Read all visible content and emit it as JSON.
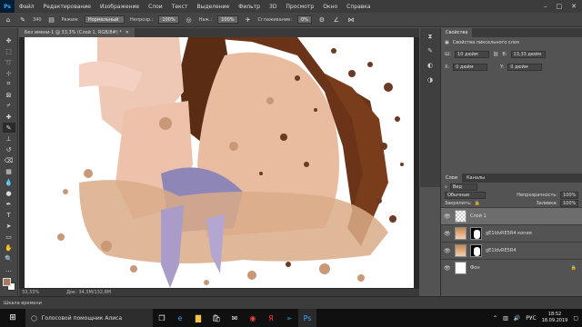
{
  "menu": {
    "items": [
      "Файл",
      "Редактирование",
      "Изображение",
      "Слои",
      "Текст",
      "Выделение",
      "Фильтр",
      "3D",
      "Просмотр",
      "Окно",
      "Справка"
    ]
  },
  "options": {
    "size": "340",
    "mode_label": "Режим:",
    "mode_value": "Нормальный",
    "opacity_label": "Непрозр.:",
    "opacity_value": "100%",
    "press_label": "Наж.:",
    "press_value": "100%",
    "smooth_label": "Сглаживание:",
    "smooth_value": "0%"
  },
  "document": {
    "tab_title": "Без имени-1 @ 33,3% (Слой 1, RGB/8#) *",
    "zoom": "33,33%",
    "doc_size": "Док: 34,3М/132,8М"
  },
  "timeline": {
    "label": "Шкала времени"
  },
  "properties": {
    "tab": "Свойства",
    "header": "Свойства пиксельного слоя",
    "w_label": "Ш:",
    "w_value": "10 дюйм",
    "h_label": "В:",
    "h_value": "13,33 дюйм",
    "x_label": "X:",
    "x_value": "0 дюйм",
    "y_label": "Y:",
    "y_value": "0 дюйм"
  },
  "layers_panel": {
    "tabs": [
      "Слои",
      "Каналы"
    ],
    "kind": "Вид",
    "blend": "Обычные",
    "opacity_label": "Непрозрачность:",
    "opacity_value": "100%",
    "lock_label": "Закрепить:",
    "fill_label": "Заливка:",
    "fill_value": "100%"
  },
  "layers": [
    {
      "name": "Слой 1",
      "thumb": "check",
      "selected": true
    },
    {
      "name": "gE1ldvRE5R4 копия",
      "thumb": "img",
      "mask": true,
      "selected": false
    },
    {
      "name": "gE1ldvRE5R4",
      "thumb": "img",
      "mask": true,
      "selected": false
    },
    {
      "name": "Фон",
      "thumb": "white",
      "selected": false
    }
  ],
  "taskbar": {
    "search_text": "Голосовой помощник Алиса",
    "lang": "РУС",
    "time": "18:52",
    "date": "18.09.2019"
  },
  "colors": {
    "fg": "#a47a62",
    "bg": "#ffffff",
    "hair": "#5a2c14",
    "skin": "#e7b79a",
    "splash": "#b08060",
    "lavender": "#a99cc8"
  }
}
